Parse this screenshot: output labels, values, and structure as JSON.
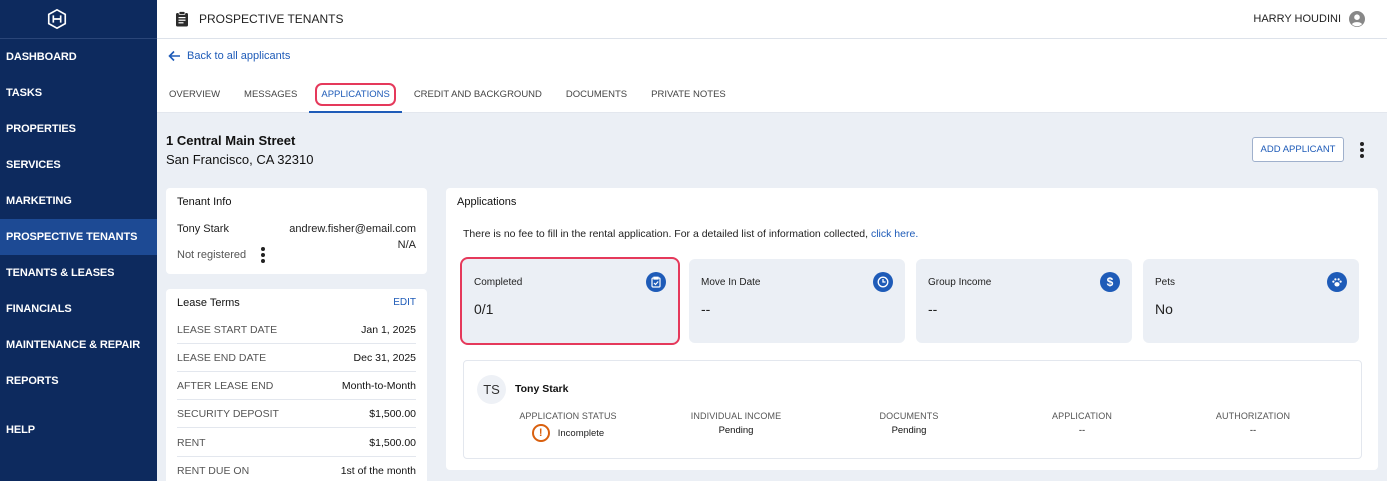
{
  "sidebar": {
    "logo": "logo-icon",
    "items": [
      {
        "label": "DASHBOARD"
      },
      {
        "label": "TASKS"
      },
      {
        "label": "PROPERTIES"
      },
      {
        "label": "SERVICES"
      },
      {
        "label": "MARKETING"
      },
      {
        "label": "PROSPECTIVE TENANTS",
        "active": true
      },
      {
        "label": "TENANTS & LEASES"
      },
      {
        "label": "FINANCIALS"
      },
      {
        "label": "MAINTENANCE & REPAIR"
      },
      {
        "label": "REPORTS"
      }
    ],
    "help": "HELP"
  },
  "topbar": {
    "page_title": "PROSPECTIVE TENANTS",
    "user_name": "HARRY HOUDINI"
  },
  "subhead": {
    "back_label": "Back to all applicants",
    "tabs": [
      {
        "label": "OVERVIEW"
      },
      {
        "label": "MESSAGES"
      },
      {
        "label": "APPLICATIONS",
        "active": true
      },
      {
        "label": "CREDIT AND BACKGROUND"
      },
      {
        "label": "DOCUMENTS"
      },
      {
        "label": "PRIVATE NOTES"
      }
    ]
  },
  "property": {
    "street": "1 Central Main Street",
    "city": "San Francisco, CA 32310",
    "add_applicant_label": "ADD APPLICANT"
  },
  "tenant_info": {
    "title": "Tenant Info",
    "name": "Tony Stark",
    "email": "andrew.fisher@email.com",
    "phone": "N/A",
    "registration": "Not registered"
  },
  "lease_terms": {
    "title": "Lease Terms",
    "edit_label": "EDIT",
    "rows": [
      {
        "key": "LEASE START DATE",
        "value": "Jan 1, 2025"
      },
      {
        "key": "LEASE END DATE",
        "value": "Dec 31, 2025"
      },
      {
        "key": "AFTER LEASE END",
        "value": "Month-to-Month"
      },
      {
        "key": "SECURITY DEPOSIT",
        "value": "$1,500.00"
      },
      {
        "key": "RENT",
        "value": "$1,500.00"
      },
      {
        "key": "RENT DUE ON",
        "value": "1st of the month"
      }
    ]
  },
  "applications": {
    "title": "Applications",
    "note": "There is no fee to fill in the rental application. For a detailed list of information collected, ",
    "note_link": "click here.",
    "stats": [
      {
        "label": "Completed",
        "value": "0/1",
        "icon": "clipboard-check-icon"
      },
      {
        "label": "Move In Date",
        "value": "--",
        "icon": "clock-icon"
      },
      {
        "label": "Group Income",
        "value": "--",
        "icon": "dollar-icon"
      },
      {
        "label": "Pets",
        "value": "No",
        "icon": "paw-icon"
      }
    ],
    "applicant": {
      "initials": "TS",
      "name": "Tony Stark",
      "columns": [
        {
          "header": "APPLICATION STATUS",
          "value": "Incomplete"
        },
        {
          "header": "INDIVIDUAL INCOME",
          "value": "Pending"
        },
        {
          "header": "DOCUMENTS",
          "value": "Pending"
        },
        {
          "header": "APPLICATION",
          "value": "--"
        },
        {
          "header": "AUTHORIZATION",
          "value": "--"
        }
      ]
    }
  },
  "colors": {
    "sidebar_bg": "#0d2a5e",
    "sidebar_active": "#1d4a94",
    "accent": "#1e5bb8",
    "highlight": "#e5395b",
    "warning": "#d9600f",
    "content_bg": "#ebeff5"
  }
}
